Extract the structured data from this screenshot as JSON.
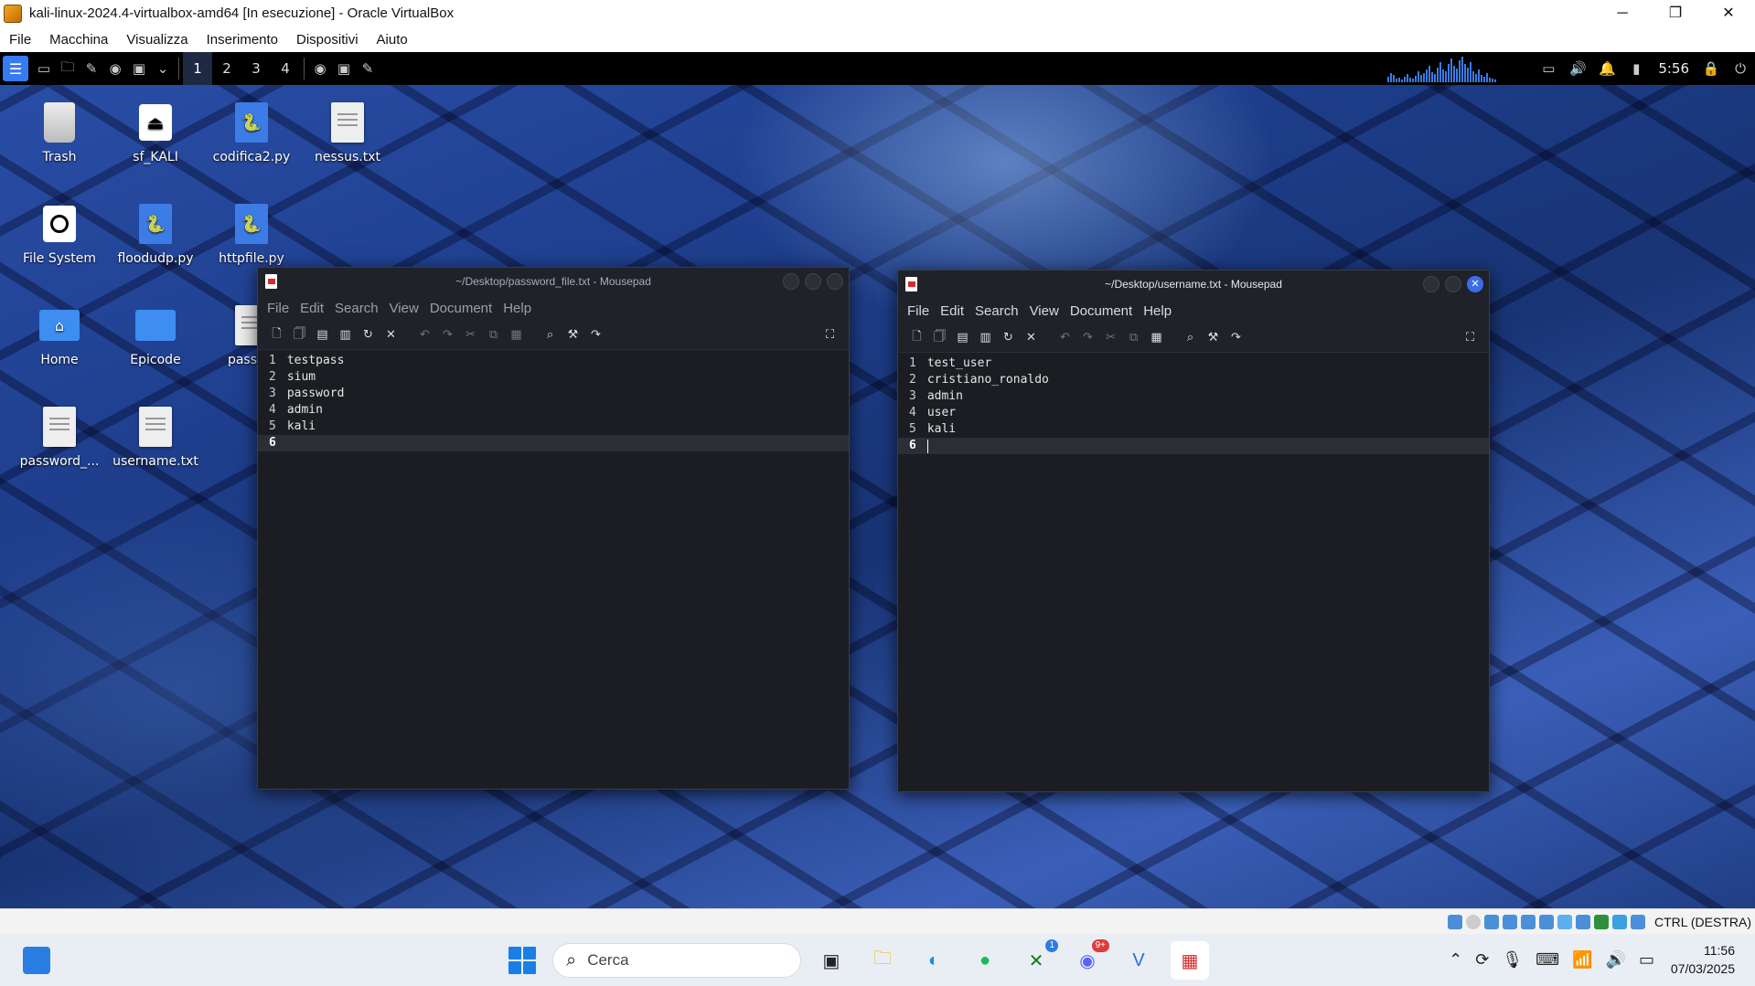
{
  "vb_window": {
    "title": "kali-linux-2024.4-virtualbox-amd64 [In esecuzione] - Oracle VirtualBox",
    "controls": [
      "─",
      "❐",
      "✕"
    ],
    "menu": [
      "File",
      "Macchina",
      "Visualizza",
      "Inserimento",
      "Dispositivi",
      "Aiuto"
    ],
    "status_host_key": "CTRL (DESTRA)"
  },
  "kali_panel": {
    "workspaces": [
      "1",
      "2",
      "3",
      "4"
    ],
    "clock": "5:56",
    "accent": "#367bf0"
  },
  "desktop_icons": [
    {
      "label": "Trash",
      "icon": "trash-icon"
    },
    {
      "label": "sf_KALI",
      "icon": "drive-icon"
    },
    {
      "label": "codifica2.py",
      "icon": "python-file-icon"
    },
    {
      "label": "nessus.txt",
      "icon": "text-file-icon"
    },
    {
      "label": "File System",
      "icon": "filesystem-icon"
    },
    {
      "label": "floodudp.py",
      "icon": "python-file-icon"
    },
    {
      "label": "httpfile.py",
      "icon": "python-file-icon"
    },
    {
      "label": "Home",
      "icon": "home-folder-icon"
    },
    {
      "label": "Epicode",
      "icon": "folder-icon"
    },
    {
      "label": "passwo",
      "icon": "text-file-icon"
    },
    {
      "label": "password_...",
      "icon": "text-file-icon"
    },
    {
      "label": "username.txt",
      "icon": "text-file-icon"
    }
  ],
  "mousepad_left": {
    "title": "~/Desktop/password_file.txt - Mousepad",
    "menu": [
      "File",
      "Edit",
      "Search",
      "View",
      "Document",
      "Help"
    ],
    "lines": [
      {
        "n": "1",
        "text": "testpass"
      },
      {
        "n": "2",
        "text": "sium"
      },
      {
        "n": "3",
        "text": "password"
      },
      {
        "n": "4",
        "text": "admin"
      },
      {
        "n": "5",
        "text": "kali"
      },
      {
        "n": "6",
        "text": ""
      }
    ]
  },
  "mousepad_right": {
    "title": "~/Desktop/username.txt - Mousepad",
    "menu": [
      "File",
      "Edit",
      "Search",
      "View",
      "Document",
      "Help"
    ],
    "lines": [
      {
        "n": "1",
        "text": "test_user"
      },
      {
        "n": "2",
        "text": "cristiano_ronaldo"
      },
      {
        "n": "3",
        "text": "admin"
      },
      {
        "n": "4",
        "text": "user"
      },
      {
        "n": "5",
        "text": "kali"
      },
      {
        "n": "6",
        "text": ""
      }
    ]
  },
  "windows_taskbar": {
    "search_placeholder": "Cerca",
    "xbox_badge": "1",
    "discord_badge": "9+",
    "time": "11:56",
    "date": "07/03/2025"
  }
}
